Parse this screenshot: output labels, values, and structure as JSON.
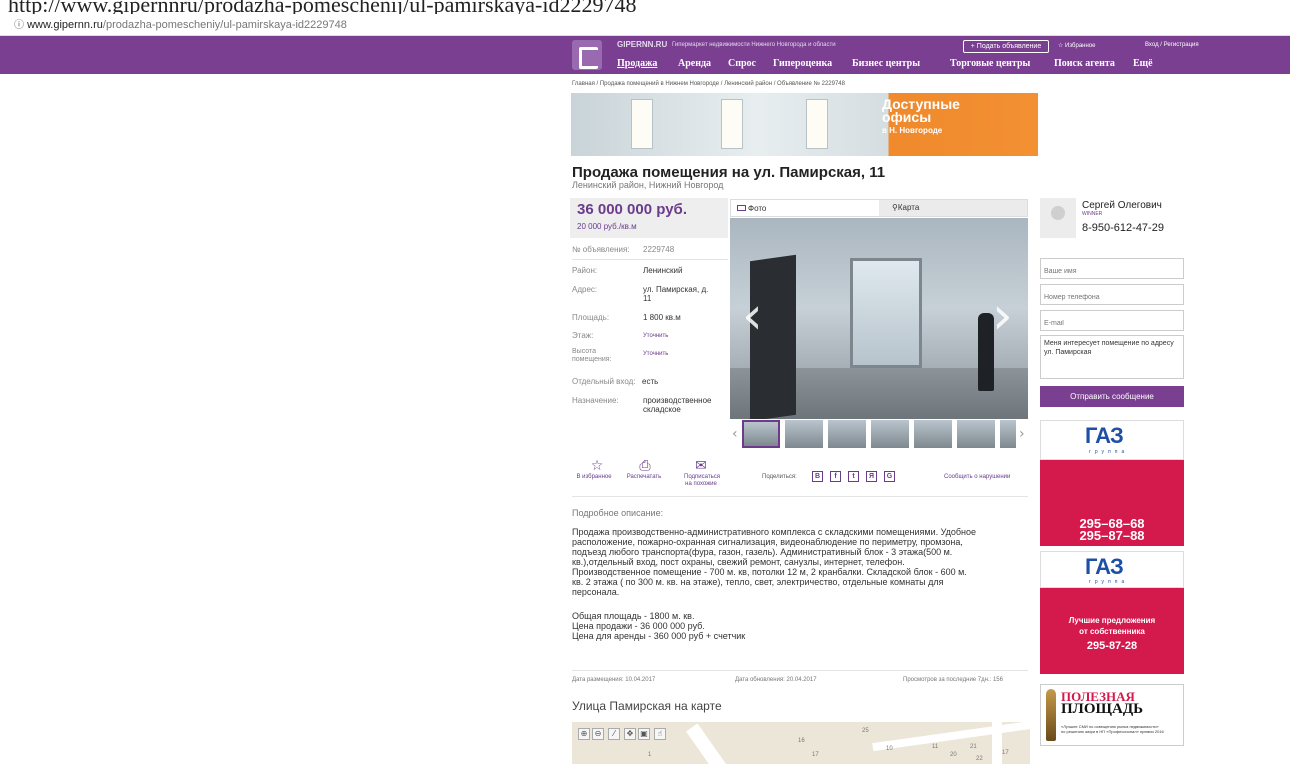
{
  "browser": {
    "top_url_text": "http://www.gipernnru/prodazha-pomeschenij/ul-pamirskaya-id2229748",
    "url_domain": "www.gipernn.ru",
    "url_path": "/prodazha-pomescheniy/ul-pamirskaya-id2229748",
    "info_icon": "info-circle-icon"
  },
  "header": {
    "site_name": "GIPERNN.RU",
    "tagline": "Гипермаркет недвижимости Нижнего Новгорода и области",
    "post_ad": "+ Подать объявление",
    "favorites": "Избранное",
    "login": "Вход / Регистрация",
    "nav": [
      "Продажа",
      "Аренда",
      "Спрос",
      "Гипероценка",
      "Бизнес центры",
      "Торговые центры",
      "Поиск агента",
      "Ещё"
    ]
  },
  "breadcrumb": "Главная / Продажа помещений в Нижнем Новгороде / Ленинский район / Объявление № 2229748",
  "banner": {
    "line1": "Доступные",
    "line2": "офисы",
    "line3": "в Н. Новгороде"
  },
  "listing": {
    "title": "Продажа помещения на ул. Памирская, 11",
    "subtitle": "Ленинский район, Нижний Новгород",
    "price": "36 000 000 руб.",
    "price_per_sqm": "20 000 руб./кв.м",
    "ad_number_label": "№ объявления:",
    "ad_number": "2229748",
    "district_label": "Район:",
    "district": "Ленинский",
    "address_label": "Адрес:",
    "address_line1": "ул. Памирская, д.",
    "address_line2": "11",
    "area_label": "Площадь:",
    "area": "1 800 кв.м",
    "floor_label": "Этаж:",
    "floor": "Уточнить",
    "height_label1": "Высота",
    "height_label2": "помещения:",
    "height": "Уточнить",
    "entrance_label": "Отдельный вход:",
    "entrance": "есть",
    "purpose_label": "Назначение:",
    "purpose_line1": "производственное",
    "purpose_line2": "складское"
  },
  "media": {
    "tab_photo": "Фото",
    "tab_map": "Карта",
    "prev_arrow": "‹",
    "next_arrow": "›",
    "thumb_prev": "‹",
    "thumb_next": "›"
  },
  "actions": {
    "favorite": "В избранное",
    "print": "Распечатать",
    "subscribe_line1": "Подписаться",
    "subscribe_line2": "на похожие",
    "share": "Поделиться:",
    "share_buttons": [
      "В",
      "f",
      "t",
      "Я",
      "G"
    ],
    "report": "Сообщить о нарушении"
  },
  "description": {
    "title": "Подробное описание:",
    "lines": [
      "Продажа производственно-административного комплекса с складскими помещениями. Удобное",
      "расположение, пожарно-охранная сигнализация, видеонаблюдение по периметру, промзона,",
      "подъезд любого транспорта(фура, газон, газель). Административный блок - 3 этажа(500 м.",
      "кв.),отдельный вход, пост охраны, свежий ремонт, санузлы, интернет, телефон.",
      "Производственное помещение - 700 м. кв, потолки 12 м, 2 кранбалки. Складской блок - 600 м.",
      "кв. 2 этажа ( по 300 м. кв. на этаже), тепло, свет, электричество, отдельные комнаты для",
      "персонала."
    ],
    "summary": [
      "Общая площадь - 1800 м. кв.",
      "Цена продажи - 36 000 000 руб.",
      "Цена для аренды - 360 000 руб + счетчик"
    ],
    "date_posted": "Дата размещения: 10.04.2017",
    "date_updated": "Дата обновления: 20.04.2017",
    "views": "Просмотров за последние 7дн.: 156"
  },
  "map_section": {
    "title": "Улица Памирская на карте",
    "tools": [
      "⊕",
      "⊖",
      "⁄",
      "✥",
      "▣",
      "☝"
    ],
    "labels": [
      "1",
      "16",
      "17",
      "25",
      "10",
      "11",
      "20",
      "21",
      "22",
      "17"
    ]
  },
  "agent": {
    "name": "Сергей Олегович",
    "role": "WINNER",
    "phone": "8-950-612-47-29"
  },
  "contact_form": {
    "name_placeholder": "Ваше имя",
    "phone_placeholder": "Номер телефона",
    "email_placeholder": "E-mail",
    "message": "Меня интересует помещение по адресу ул. Памирская",
    "submit": "Отправить сообщение"
  },
  "ads": {
    "gaz_logo": "ГАЗ",
    "gaz_sub": "группа",
    "ad1_phone1": "295–68–68",
    "ad1_phone2": "295–87–88",
    "ad2_text1": "Лучшие предложения",
    "ad2_text2": "от собственника",
    "ad2_phone": "295-87-28",
    "ad3_title1": "ПОЛЕЗНАЯ",
    "ad3_title2": "ПЛОЩАДЬ",
    "ad3_line1": "«Лучшее СМИ по освещению рынка недвижимости»",
    "ad3_line2": "по решению жюри в НП «Профессионал» премии 2016"
  },
  "colors": {
    "brand_purple": "#7a3f91",
    "ad_red": "#d4194d",
    "banner_orange": "#f08a2c"
  }
}
